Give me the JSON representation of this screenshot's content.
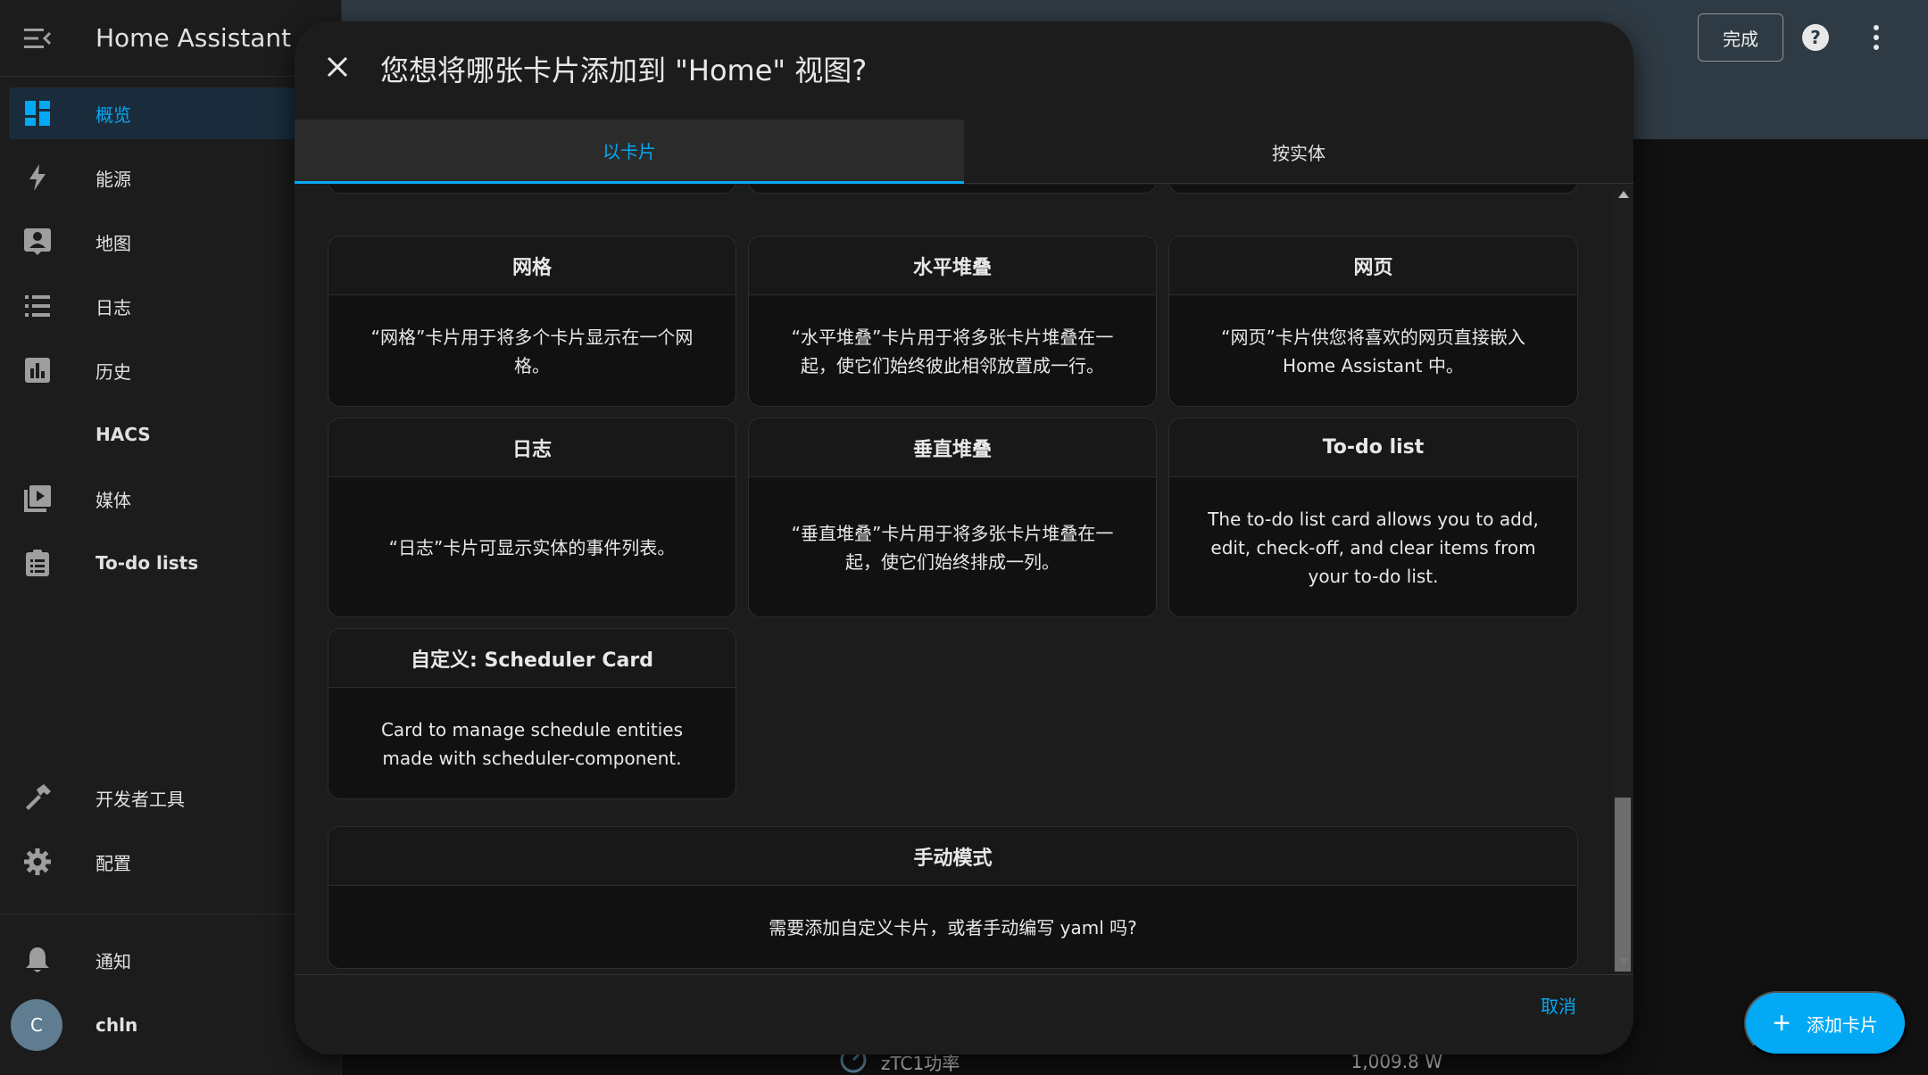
{
  "app": {
    "title": "Home Assistant"
  },
  "sidebar": {
    "items": [
      {
        "label": "概览",
        "icon": "dashboard-icon",
        "active": true
      },
      {
        "label": "能源",
        "icon": "lightning-icon"
      },
      {
        "label": "地图",
        "icon": "map-account-icon"
      },
      {
        "label": "日志",
        "icon": "list-icon"
      },
      {
        "label": "历史",
        "icon": "chart-bar-icon"
      },
      {
        "label": "HACS",
        "icon": ""
      },
      {
        "label": "媒体",
        "icon": "media-play-icon"
      },
      {
        "label": "To-do lists",
        "icon": "clipboard-list-icon"
      }
    ],
    "bottom_items": [
      {
        "label": "开发者工具",
        "icon": "hammer-icon"
      },
      {
        "label": "配置",
        "icon": "gear-icon"
      }
    ],
    "notifications": {
      "label": "通知",
      "icon": "bell-icon"
    },
    "user": {
      "initial": "C",
      "name": "chln"
    }
  },
  "toolbar": {
    "done_label": "完成"
  },
  "dialog": {
    "title": "您想将哪张卡片添加到 \"Home\" 视图?",
    "tabs": [
      {
        "label": "以卡片",
        "active": true
      },
      {
        "label": "按实体"
      }
    ],
    "cards": [
      {
        "title": "网格",
        "desc": "“网格”卡片用于将多个卡片显示在一个网格。"
      },
      {
        "title": "水平堆叠",
        "desc": "“水平堆叠”卡片用于将多张卡片堆叠在一起，使它们始终彼此相邻放置成一行。"
      },
      {
        "title": "网页",
        "desc": "“网页”卡片供您将喜欢的网页直接嵌入 Home Assistant 中。"
      },
      {
        "title": "日志",
        "desc": "“日志”卡片可显示实体的事件列表。"
      },
      {
        "title": "垂直堆叠",
        "desc": "“垂直堆叠”卡片用于将多张卡片堆叠在一起，使它们始终排成一列。"
      },
      {
        "title": "To-do list",
        "desc": "The to-do list card allows you to add, edit, check-off, and clear items from your to-do list."
      },
      {
        "title": "自定义: Scheduler Card",
        "desc": "Card to manage schedule entities made with scheduler-component."
      }
    ],
    "manual": {
      "title": "手动模式",
      "desc": "需要添加自定义卡片，或者手动编写 yaml 吗?"
    },
    "cancel_label": "取消"
  },
  "background": {
    "row_name": "zTC1功率",
    "row_value": "1,009.8 W"
  },
  "fab": {
    "label": "添加卡片"
  },
  "colors": {
    "accent": "#03a9f4",
    "sidebar_bg": "#1c1c1c",
    "dialog_bg": "#1c1c1c",
    "card_bg": "#111111"
  }
}
